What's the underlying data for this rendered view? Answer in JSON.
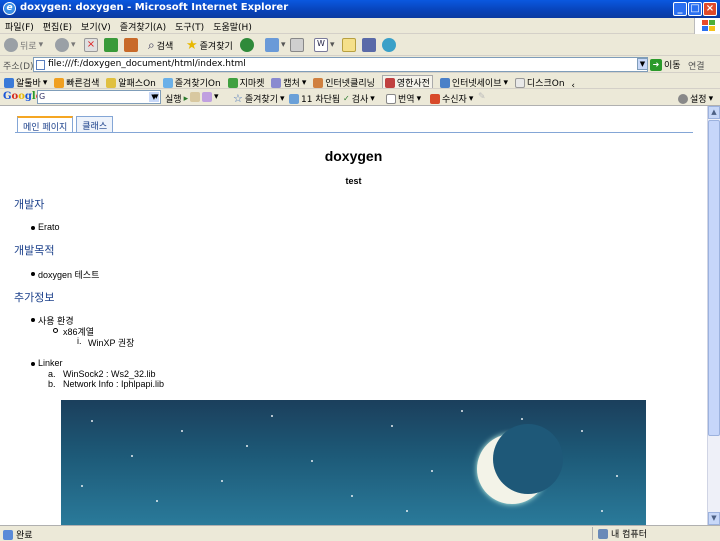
{
  "window": {
    "title": "doxygen: doxygen - Microsoft Internet Explorer"
  },
  "menu": [
    "파일(F)",
    "편집(E)",
    "보기(V)",
    "즐겨찾기(A)",
    "도구(T)",
    "도움말(H)"
  ],
  "toolbar": {
    "back": "뒤로",
    "search": "검색",
    "favorites": "즐겨찾기"
  },
  "address": {
    "label": "주소(D)",
    "url": "file:///f:/doxygen_document/html/index.html",
    "go": "이동",
    "links": "연결"
  },
  "links": [
    "알툴바",
    "빠른검색",
    "알패스On",
    "즐겨찾기On",
    "지마켓",
    "캡처",
    "인터넷클리닝",
    "영한사전",
    "인터넷세이브",
    "디스크On"
  ],
  "google": {
    "logo": "Google",
    "search_prefix": "G",
    "run": "실행",
    "favorites": "즐겨찾기",
    "blocked": "11 차단됨",
    "check": "검사",
    "translate": "번역",
    "send": "수신자",
    "settings": "설정"
  },
  "tabs": [
    "메인 페이지",
    "클래스"
  ],
  "page": {
    "title": "doxygen",
    "brief": "test",
    "sections": [
      {
        "heading": "개발자",
        "items": [
          "Erato"
        ]
      },
      {
        "heading": "개발목적",
        "items": [
          "doxygen 테스트"
        ]
      },
      {
        "heading": "추가정보"
      }
    ],
    "env": {
      "label": "사용 환경",
      "sub": "x86계열",
      "subsub_num": "i.",
      "subsub": "WinXP 권장"
    },
    "linker": {
      "label": "Linker",
      "items": [
        {
          "num": "a.",
          "text": "WinSock2 : Ws2_32.lib"
        },
        {
          "num": "b.",
          "text": "Network Info : Iphlpapi.lib"
        }
      ]
    }
  },
  "status": {
    "left": "완료",
    "zone": "내 컴퓨터"
  }
}
